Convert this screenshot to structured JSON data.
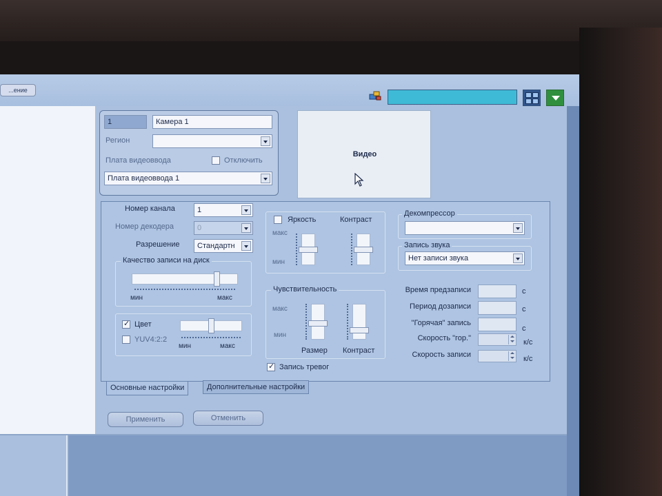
{
  "topbar": {
    "left_button_label": "...ение",
    "status_text": "",
    "colors": {
      "status_field": "#3fbad6",
      "layout_button": "#31558c",
      "minimize_button": "#2f8f3e"
    },
    "icons": [
      "network-icon",
      "layout-grid-icon",
      "minimize-arrow-icon"
    ]
  },
  "camera": {
    "id": "1",
    "name": "Камера 1",
    "region_label": "Регион",
    "region_value": "",
    "capture_board_label": "Плата видеоввода",
    "disable_label": "Отключить",
    "disable_checked": false,
    "capture_board_value": "Плата видеоввода 1"
  },
  "video": {
    "label": "Видео"
  },
  "channel": {
    "number_label": "Номер канала",
    "number_value": "1",
    "decoder_label": "Номер декодера",
    "decoder_value": "0",
    "resolution_label": "Разрешение",
    "resolution_value": "Стандартн"
  },
  "quality": {
    "title": "Качество записи на диск",
    "min": "мин",
    "max": "макс",
    "level": 0.82
  },
  "color": {
    "color_label": "Цвет",
    "color_checked": true,
    "yuv_label": "YUV4:2:2",
    "yuv_checked": false,
    "min": "мин",
    "max": "макс",
    "level": 0.5
  },
  "brightness": {
    "checkbox_label": "Яркость",
    "checked": false,
    "contrast_label": "Контраст",
    "max": "макс",
    "min": "мин",
    "brightness_level": 0.5,
    "contrast_level": 0.5
  },
  "sensitivity": {
    "title": "Чувствительность",
    "max": "макс",
    "min": "мин",
    "size_label": "Размер",
    "contrast_label": "Контраст",
    "size_level": 0.45,
    "contrast_level": 0.2
  },
  "alarm_record": {
    "label": "Запись тревог",
    "checked": true
  },
  "decompressor": {
    "title": "Декомпрессор",
    "value": ""
  },
  "sound": {
    "title": "Запись звука",
    "value": "Нет записи звука"
  },
  "timing": {
    "prerecord_label": "Время предзаписи",
    "postrecord_label": "Период дозаписи",
    "hot_record_label": "\"Горячая\" запись",
    "hot_speed_label": "Скорость \"гор.\"",
    "record_speed_label": "Скорость записи",
    "unit_seconds": "с",
    "unit_fps": "к/с"
  },
  "tabs": [
    {
      "label": "Основные настройки",
      "active": true
    },
    {
      "label": "Дополнительные настройки",
      "active": false
    }
  ],
  "buttons": {
    "apply": "Применить",
    "cancel": "Отменить"
  }
}
